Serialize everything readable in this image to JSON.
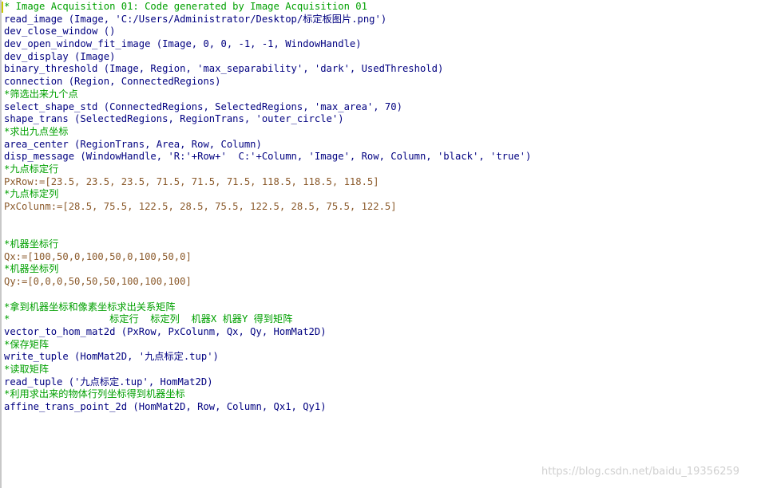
{
  "editor": {
    "lines": [
      {
        "text": "* Image Acquisition 01: Code generated by Image Acquisition 01",
        "kind": "comment"
      },
      {
        "text": "read_image (Image, 'C:/Users/Administrator/Desktop/标定板图片.png')",
        "kind": "op"
      },
      {
        "text": "dev_close_window ()",
        "kind": "op"
      },
      {
        "text": "dev_open_window_fit_image (Image, 0, 0, -1, -1, WindowHandle)",
        "kind": "op"
      },
      {
        "text": "dev_display (Image)",
        "kind": "op"
      },
      {
        "text": "binary_threshold (Image, Region, 'max_separability', 'dark', UsedThreshold)",
        "kind": "op"
      },
      {
        "text": "connection (Region, ConnectedRegions)",
        "kind": "op"
      },
      {
        "text": "*筛选出来九个点",
        "kind": "comment"
      },
      {
        "text": "select_shape_std (ConnectedRegions, SelectedRegions, 'max_area', 70)",
        "kind": "op"
      },
      {
        "text": "shape_trans (SelectedRegions, RegionTrans, 'outer_circle')",
        "kind": "op"
      },
      {
        "text": "*求出九点坐标",
        "kind": "comment"
      },
      {
        "text": "area_center (RegionTrans, Area, Row, Column)",
        "kind": "op"
      },
      {
        "text": "disp_message (WindowHandle, 'R:'+Row+'  C:'+Column, 'Image', Row, Column, 'black', 'true')",
        "kind": "op"
      },
      {
        "text": "*九点标定行",
        "kind": "comment"
      },
      {
        "text": "PxRow:=[23.5, 23.5, 23.5, 71.5, 71.5, 71.5, 118.5, 118.5, 118.5]",
        "kind": "assign"
      },
      {
        "text": "*九点标定列",
        "kind": "comment"
      },
      {
        "text": "PxColunm:=[28.5, 75.5, 122.5, 28.5, 75.5, 122.5, 28.5, 75.5, 122.5]",
        "kind": "assign"
      },
      {
        "text": "",
        "kind": "blank"
      },
      {
        "text": "",
        "kind": "blank"
      },
      {
        "text": "*机器坐标行",
        "kind": "comment"
      },
      {
        "text": "Qx:=[100,50,0,100,50,0,100,50,0]",
        "kind": "assign"
      },
      {
        "text": "*机器坐标列",
        "kind": "comment"
      },
      {
        "text": "Qy:=[0,0,0,50,50,50,100,100,100]",
        "kind": "assign"
      },
      {
        "text": "",
        "kind": "blank"
      },
      {
        "text": "*拿到机器坐标和像素坐标求出关系矩阵",
        "kind": "comment"
      },
      {
        "text": "*                 标定行  标定列  机器X 机器Y 得到矩阵",
        "kind": "comment"
      },
      {
        "text": "vector_to_hom_mat2d (PxRow, PxColunm, Qx, Qy, HomMat2D)",
        "kind": "op"
      },
      {
        "text": "*保存矩阵",
        "kind": "comment"
      },
      {
        "text": "write_tuple (HomMat2D, '九点标定.tup')",
        "kind": "op"
      },
      {
        "text": "*读取矩阵",
        "kind": "comment"
      },
      {
        "text": "read_tuple ('九点标定.tup', HomMat2D)",
        "kind": "op"
      },
      {
        "text": "*利用求出来的物体行列坐标得到机器坐标",
        "kind": "comment"
      },
      {
        "text": "affine_trans_point_2d (HomMat2D, Row, Column, Qx1, Qy1)",
        "kind": "op"
      }
    ]
  },
  "watermark": "https://blog.csdn.net/baidu_19356259"
}
